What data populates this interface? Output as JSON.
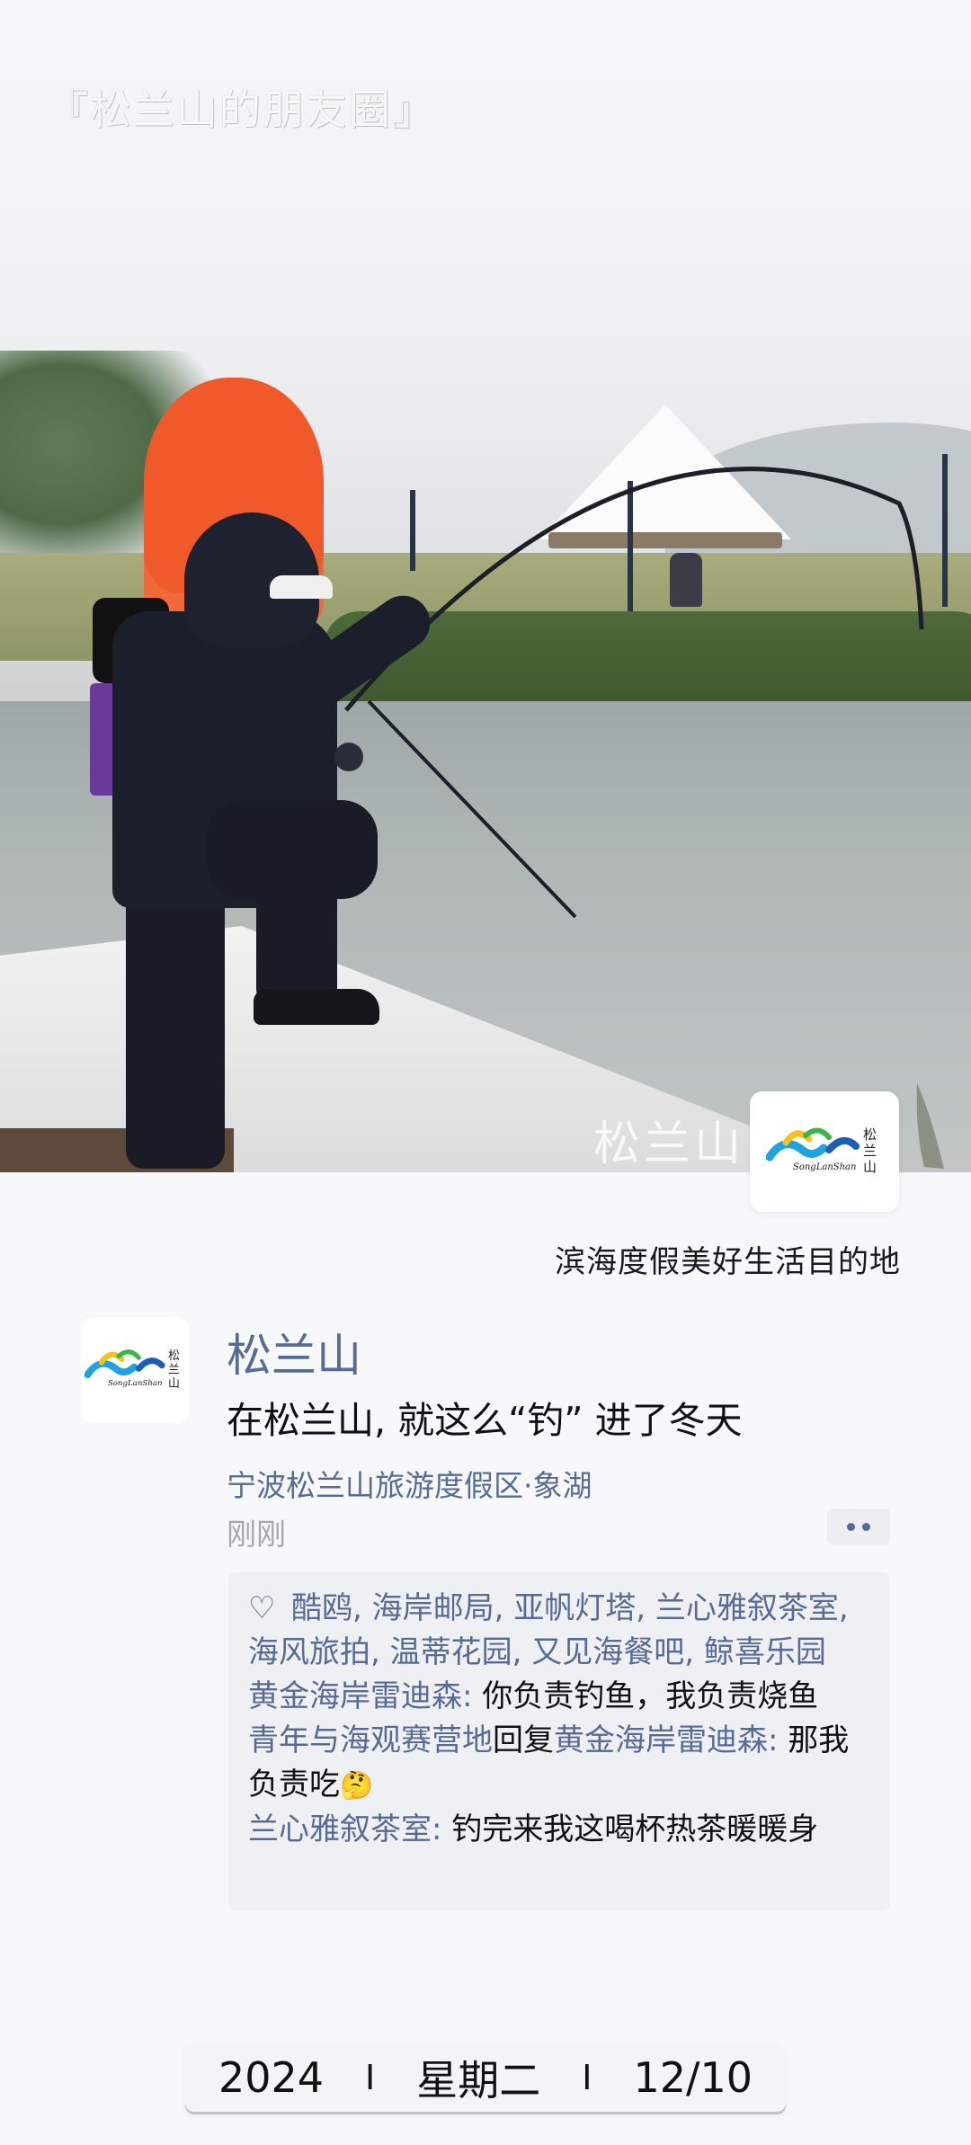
{
  "hero": {
    "title": "『松兰山的朋友圈』",
    "watermark_text": "松兰山",
    "logo_text": "SongLanShan"
  },
  "tagline": "滨海度假美好生活目的地",
  "post": {
    "author": "松兰山",
    "text": "在松兰山, 就这么“钓” 进了冬天",
    "location": "宁波松兰山旅游度假区·象湖",
    "time": "刚刚"
  },
  "likes": {
    "icon": "heart-outline",
    "names": "酷鸥, 海岸邮局, 亚帆灯塔, 兰心雅叙茶室, 海风旅拍, 温蒂花园, 又见海餐吧, 鲸喜乐园"
  },
  "comments": [
    {
      "name": "黄金海岸雷迪森",
      "reply_word": "",
      "reply_to": "",
      "sep": ": ",
      "text": "你负责钓鱼，我负责烧鱼",
      "emoji": ""
    },
    {
      "name": "青年与海观赛营地",
      "reply_word": "回复",
      "reply_to": "黄金海岸雷迪森",
      "sep": ": ",
      "text": "那我负责吃",
      "emoji": "🤔"
    },
    {
      "name": "兰心雅叙茶室",
      "reply_word": "",
      "reply_to": "",
      "sep": ": ",
      "text": "钓完来我这喝杯热茶暖暖身",
      "emoji": ""
    }
  ],
  "date_bar": {
    "year": "2024",
    "weekday": "星期二",
    "date": "12/10",
    "separator": "I"
  },
  "colors": {
    "link_blue": "#576b95",
    "comment_bg": "#eff0f3",
    "page_bg": "#f7f8fa"
  }
}
